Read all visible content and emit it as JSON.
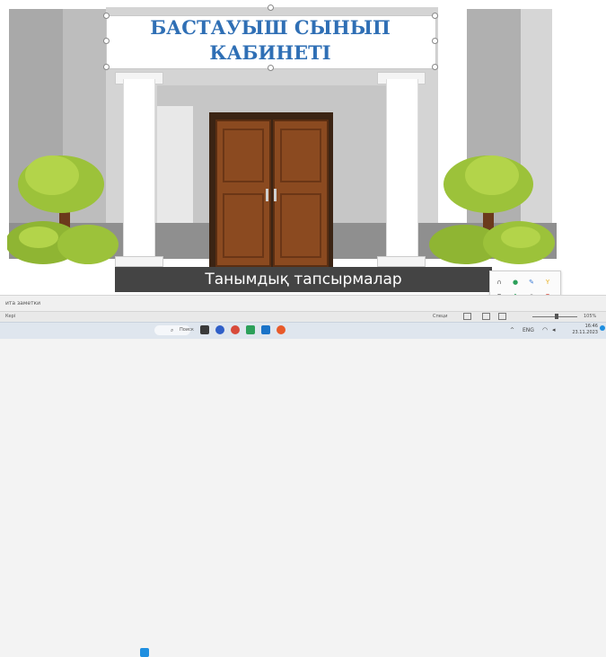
{
  "slide": {
    "title_line1": "БАСТАУЫШ СЫНЫП",
    "title_line2": "КАБИНЕТІ",
    "caption": "Танымдық тапсырмалар"
  },
  "notes": {
    "label": "ита заметки"
  },
  "statusbar": {
    "left": "Кері",
    "accessibility": "Специ",
    "zoom": "105%"
  },
  "taskbar": {
    "search_label": "Поиск",
    "lang": "ENG",
    "clock": "16:46",
    "date": "23.11.2023"
  },
  "colors": {
    "title": "#2f6fb5",
    "caption_bg": "#444444",
    "door": "#8b4a20",
    "tree": "#9cc23a"
  },
  "icons": [
    "windows-icon",
    "search-icon",
    "files-icon",
    "chat-icon",
    "chrome-icon",
    "mail-icon",
    "edge-icon",
    "wifi-icon",
    "sound-icon"
  ]
}
